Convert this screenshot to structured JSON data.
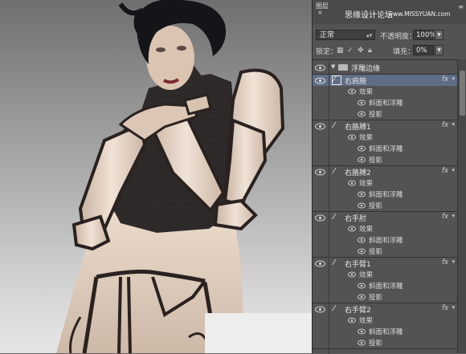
{
  "canvas": {
    "background_top": "#6f6f6f",
    "background_bottom": "#e6e6e6"
  },
  "panel": {
    "title": "图层",
    "close_glyph": "×",
    "menu_glyph": "≡",
    "watermark": "思缘设计论坛",
    "watermark_url": "www.MISSYUAN.com",
    "blend_mode": "正常",
    "opacity_label": "不透明度：",
    "opacity_value": "100%",
    "lock_label": "锁定：",
    "fill_label": "填充：",
    "fill_value": "0%"
  },
  "layers": {
    "group": {
      "name": "浮雕边缘"
    },
    "items": [
      {
        "name": "右肩膀",
        "fx": "fx",
        "effects_label": "效果",
        "effect1": "斜面和浮雕",
        "effect2": "投影",
        "selected": true
      },
      {
        "name": "右胳膊1",
        "fx": "fx",
        "effects_label": "效果",
        "effect1": "斜面和浮雕",
        "effect2": "投影"
      },
      {
        "name": "右胳膊2",
        "fx": "fx",
        "effects_label": "效果",
        "effect1": "斜面和浮雕",
        "effect2": "投影"
      },
      {
        "name": "右手肘",
        "fx": "fx",
        "effects_label": "效果",
        "effect1": "斜面和浮雕",
        "effect2": "投影"
      },
      {
        "name": "右手臂1",
        "fx": "fx",
        "effects_label": "效果",
        "effect1": "斜面和浮雕",
        "effect2": "投影"
      },
      {
        "name": "右手臂2",
        "fx": "fx",
        "effects_label": "效果",
        "effect1": "斜面和浮雕",
        "effect2": "投影"
      }
    ]
  },
  "icons": {
    "eye": "eye-icon",
    "brush": "brush-icon",
    "folder": "folder-icon",
    "lock": "lock-icon"
  },
  "colors": {
    "panel_bg": "#535353",
    "selected_row": "#5f6e86",
    "skin": "#e6d4c4",
    "seam": "#2a2220",
    "top": "#2b2726"
  }
}
